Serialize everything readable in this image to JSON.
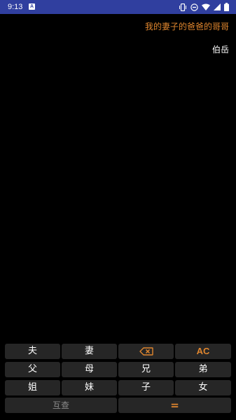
{
  "status_bar": {
    "time": "9:13",
    "notification_icon": "A"
  },
  "display": {
    "expression": "我的妻子的爸爸的哥哥",
    "result": "伯岳"
  },
  "keypad": {
    "row1": {
      "husband": "夫",
      "wife": "妻",
      "backspace_icon": "backspace-icon",
      "clear": "AC"
    },
    "row2": {
      "father": "父",
      "mother": "母",
      "elder_brother": "兄",
      "younger_brother": "弟"
    },
    "row3": {
      "elder_sister": "姐",
      "younger_sister": "妹",
      "son": "子",
      "daughter": "女"
    },
    "row4": {
      "reverse_lookup": "互查",
      "equals": "="
    }
  },
  "colors": {
    "status_bar_bg": "#303f9f",
    "accent": "#e0862e",
    "key_bg": "#262626",
    "background": "#000000"
  }
}
